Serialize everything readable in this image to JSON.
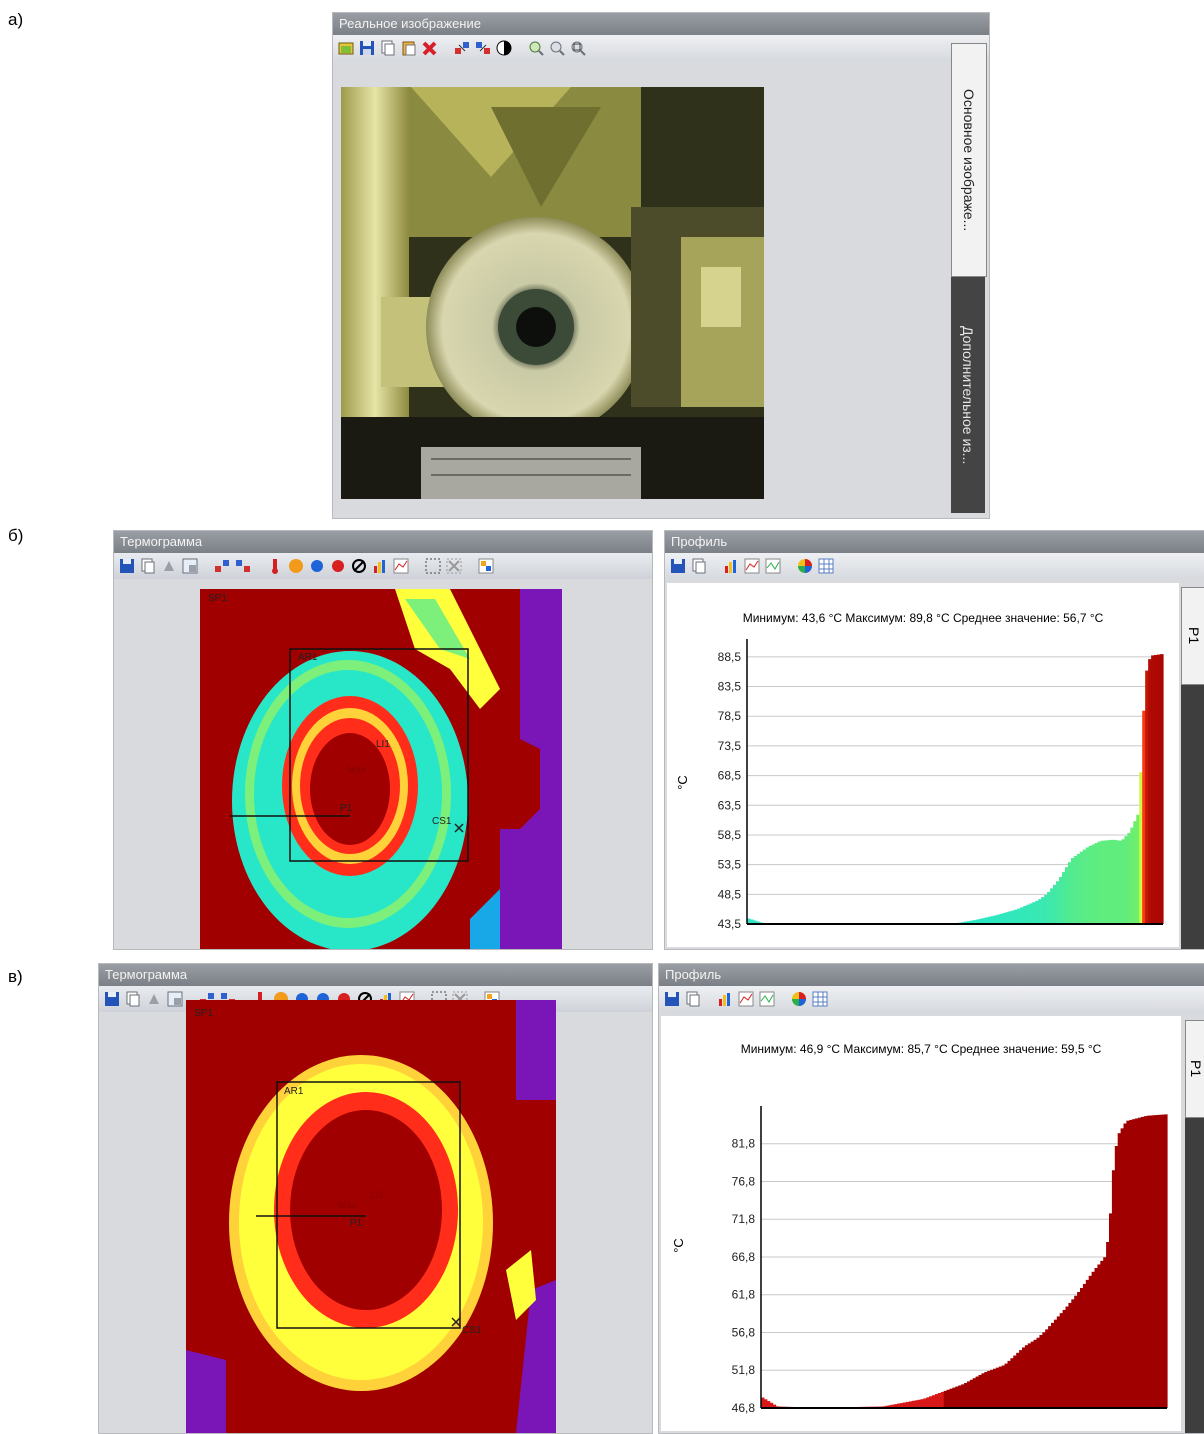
{
  "labels": {
    "a": "а)",
    "b": "б)",
    "c": "в)"
  },
  "panel_a": {
    "title": "Реальное изображение",
    "tabs": [
      "Основное изображе...",
      "Дополнительное из..."
    ],
    "toolbar_icons": [
      "open-icon",
      "save-icon",
      "copy-icon",
      "paste-icon",
      "delete-icon",
      "flip-icon",
      "rotate-icon",
      "contrast-icon",
      "zoom-in-icon",
      "zoom-out-icon",
      "zoom-fit-icon"
    ]
  },
  "panel_b": {
    "thermo_title": "Термограмма",
    "profile_title": "Профиль",
    "profile_tab": "P1",
    "stats": "Минимум: 43,6 °C Максимум: 89,8 °C Среднее значение: 56,7 °C",
    "ylabel": "°C",
    "markers": {
      "sp": "SP1",
      "ar": "AR1",
      "li": "LI1",
      "cs": "CS1",
      "p": "P1",
      "max": "Max"
    }
  },
  "panel_c": {
    "thermo_title": "Термограмма",
    "profile_title": "Профиль",
    "profile_tab": "P1",
    "stats": "Минимум: 46,9 °C Максимум: 85,7 °C Среднее значение: 59,5 °C",
    "ylabel": "°C",
    "markers": {
      "sp": "SP1",
      "ar": "AR1",
      "li": "LI1",
      "cs": "CS1",
      "p": "P1",
      "max": "Max"
    }
  },
  "colors": {
    "hot": "#a00000",
    "warm": "#e31a1c",
    "mid": "#ffff3c",
    "cool": "#28e6c8",
    "cold": "#7a16b8"
  },
  "chart_data": [
    {
      "type": "area",
      "ylabel": "°C",
      "ytick_labels": [
        "88,5",
        "83,5",
        "78,5",
        "73,5",
        "68,5",
        "63,5",
        "58,5",
        "53,5",
        "48,5",
        "43,5"
      ],
      "ylim": [
        43.5,
        90.5
      ],
      "x": [
        0,
        4,
        10,
        20,
        30,
        40,
        50,
        55,
        60,
        65,
        70,
        72,
        75,
        78,
        80,
        82,
        85,
        88,
        90,
        92,
        94,
        95,
        95.5,
        96,
        97,
        100
      ],
      "series": [
        {
          "values": [
            44.5,
            43.6,
            43.6,
            43.6,
            43.6,
            43.6,
            43.6,
            44.2,
            45.0,
            46.0,
            47.5,
            48.5,
            51.0,
            54.5,
            55.5,
            56.5,
            57.5,
            57.7,
            57.5,
            59.0,
            62.0,
            73.0,
            82.0,
            86.0,
            88.7,
            89.0
          ]
        }
      ],
      "colormap": "rainbow",
      "grid": true
    },
    {
      "type": "area",
      "ylabel": "°C",
      "ytick_labels": [
        "81,8",
        "76,8",
        "71,8",
        "66,8",
        "61,8",
        "56,8",
        "51,8",
        "46,8"
      ],
      "ylim": [
        46.8,
        86.0
      ],
      "x": [
        0,
        4,
        10,
        20,
        30,
        40,
        50,
        55,
        60,
        65,
        68,
        70,
        75,
        78,
        80,
        82,
        85,
        86,
        87,
        88,
        90,
        95,
        100
      ],
      "series": [
        {
          "values": [
            48.3,
            47.0,
            46.9,
            46.9,
            47.0,
            48.0,
            50.0,
            51.5,
            52.5,
            55.0,
            56.0,
            57.0,
            60.0,
            62.0,
            63.5,
            65.0,
            67.0,
            72.0,
            80.0,
            83.0,
            84.8,
            85.5,
            85.7
          ]
        }
      ],
      "colormap": "red",
      "grid": true
    }
  ]
}
